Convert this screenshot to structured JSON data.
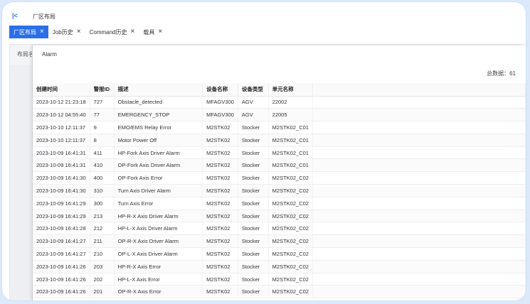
{
  "header": {
    "title": "厂区布局"
  },
  "tabs": [
    {
      "label": "厂区布局",
      "active": true
    },
    {
      "label": "Job历史",
      "active": false
    },
    {
      "label": "Command历史",
      "active": false
    },
    {
      "label": "载具",
      "active": false
    }
  ],
  "background_panel": {
    "label": "布局名"
  },
  "modal": {
    "title": "Alarm",
    "total_label": "总数据：61"
  },
  "table": {
    "columns": [
      "创建时间",
      "警报ID",
      "描述",
      "设备名称",
      "设备类型",
      "单元名称",
      ""
    ],
    "rows": [
      [
        "2023-10-12 21:23:18",
        "727",
        "Obstacle_detected",
        "MFAGV300",
        "AGV",
        "22002",
        ""
      ],
      [
        "2023-10-12 04:55:40",
        "77",
        "EMERGENCY_STOP",
        "MFAGV300",
        "AGV",
        "22005",
        ""
      ],
      [
        "2023-10-10 12:11:37",
        "9",
        "EMO/EMS Relay Error",
        "M2STK02",
        "Stocker",
        "M2STK02_C01",
        ""
      ],
      [
        "2023-10-10 12:11:37",
        "8",
        "Motor Power Off",
        "M2STK02",
        "Stocker",
        "M2STK02_C01",
        ""
      ],
      [
        "2023-10-09 16:41:31",
        "411",
        "HP-Fork Axis Driver Alarm",
        "M2STK02",
        "Stocker",
        "M2STK02_C01",
        ""
      ],
      [
        "2023-10-09 16:41:31",
        "410",
        "OP-Fork Axis Driver Alarm",
        "M2STK02",
        "Stocker",
        "M2STK02_C01",
        ""
      ],
      [
        "2023-10-09 16:41:30",
        "400",
        "OP-Fork Axis Error",
        "M2STK02",
        "Stocker",
        "M2STK02_C02",
        ""
      ],
      [
        "2023-10-09 16:41:30",
        "310",
        "Turn Axis Driver Alarm",
        "M2STK02",
        "Stocker",
        "M2STK02_C02",
        ""
      ],
      [
        "2023-10-09 16:41:29",
        "300",
        "Turn Axis Error",
        "M2STK02",
        "Stocker",
        "M2STK02_C02",
        ""
      ],
      [
        "2023-10-09 16:41:29",
        "213",
        "HP-R-X Axis Driver Alarm",
        "M2STK02",
        "Stocker",
        "M2STK02_C02",
        ""
      ],
      [
        "2023-10-09 16:41:28",
        "212",
        "HP-L-X Axis Driver Alarm",
        "M2STK02",
        "Stocker",
        "M2STK02_C02",
        ""
      ],
      [
        "2023-10-09 16:41:27",
        "211",
        "OP-R-X Axis Driver Alarm",
        "M2STK02",
        "Stocker",
        "M2STK02_C02",
        ""
      ],
      [
        "2023-10-09 16:41:27",
        "210",
        "OP-L-X Axis Driver Alarm",
        "M2STK02",
        "Stocker",
        "M2STK02_C02",
        ""
      ],
      [
        "2023-10-09 16:41:26",
        "203",
        "HP-R-X Axis Error",
        "M2STK02",
        "Stocker",
        "M2STK02_C02",
        ""
      ],
      [
        "2023-10-09 16:41:26",
        "202",
        "HP-L-X Axis Error",
        "M2STK02",
        "Stocker",
        "M2STK02_C02",
        ""
      ],
      [
        "2023-10-09 16:41:26",
        "201",
        "OP-R-X Axis Error",
        "M2STK02",
        "Stocker",
        "M2STK02_C02",
        ""
      ]
    ]
  },
  "colors": {
    "accent": "#2b6fe8",
    "frame_bg": "#dbe9fb"
  },
  "icons": {
    "collapse": "double-chevron-left-icon",
    "close": "close-icon"
  }
}
